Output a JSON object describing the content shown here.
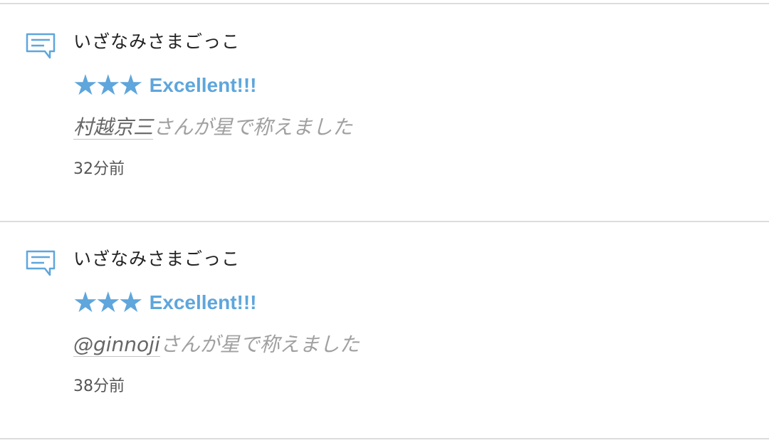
{
  "colors": {
    "accent": "#5ea6dc",
    "divider": "#dcdcdc",
    "title_text": "#222222",
    "praise_text": "#a0a0a0",
    "user_text": "#666666",
    "time_text": "#555555"
  },
  "notifications": [
    {
      "icon": "comment-icon",
      "title": "いざなみさまごっこ",
      "stars": "★★★",
      "star_count": 3,
      "rating_label": "Excellent!!!",
      "user": "村越京三",
      "praise_suffix": "さんが星で称えました",
      "time": "32分前"
    },
    {
      "icon": "comment-icon",
      "title": "いざなみさまごっこ",
      "stars": "★★★",
      "star_count": 3,
      "rating_label": "Excellent!!!",
      "user": "@ginnoji",
      "praise_suffix": "さんが星で称えました",
      "time": "38分前"
    }
  ]
}
